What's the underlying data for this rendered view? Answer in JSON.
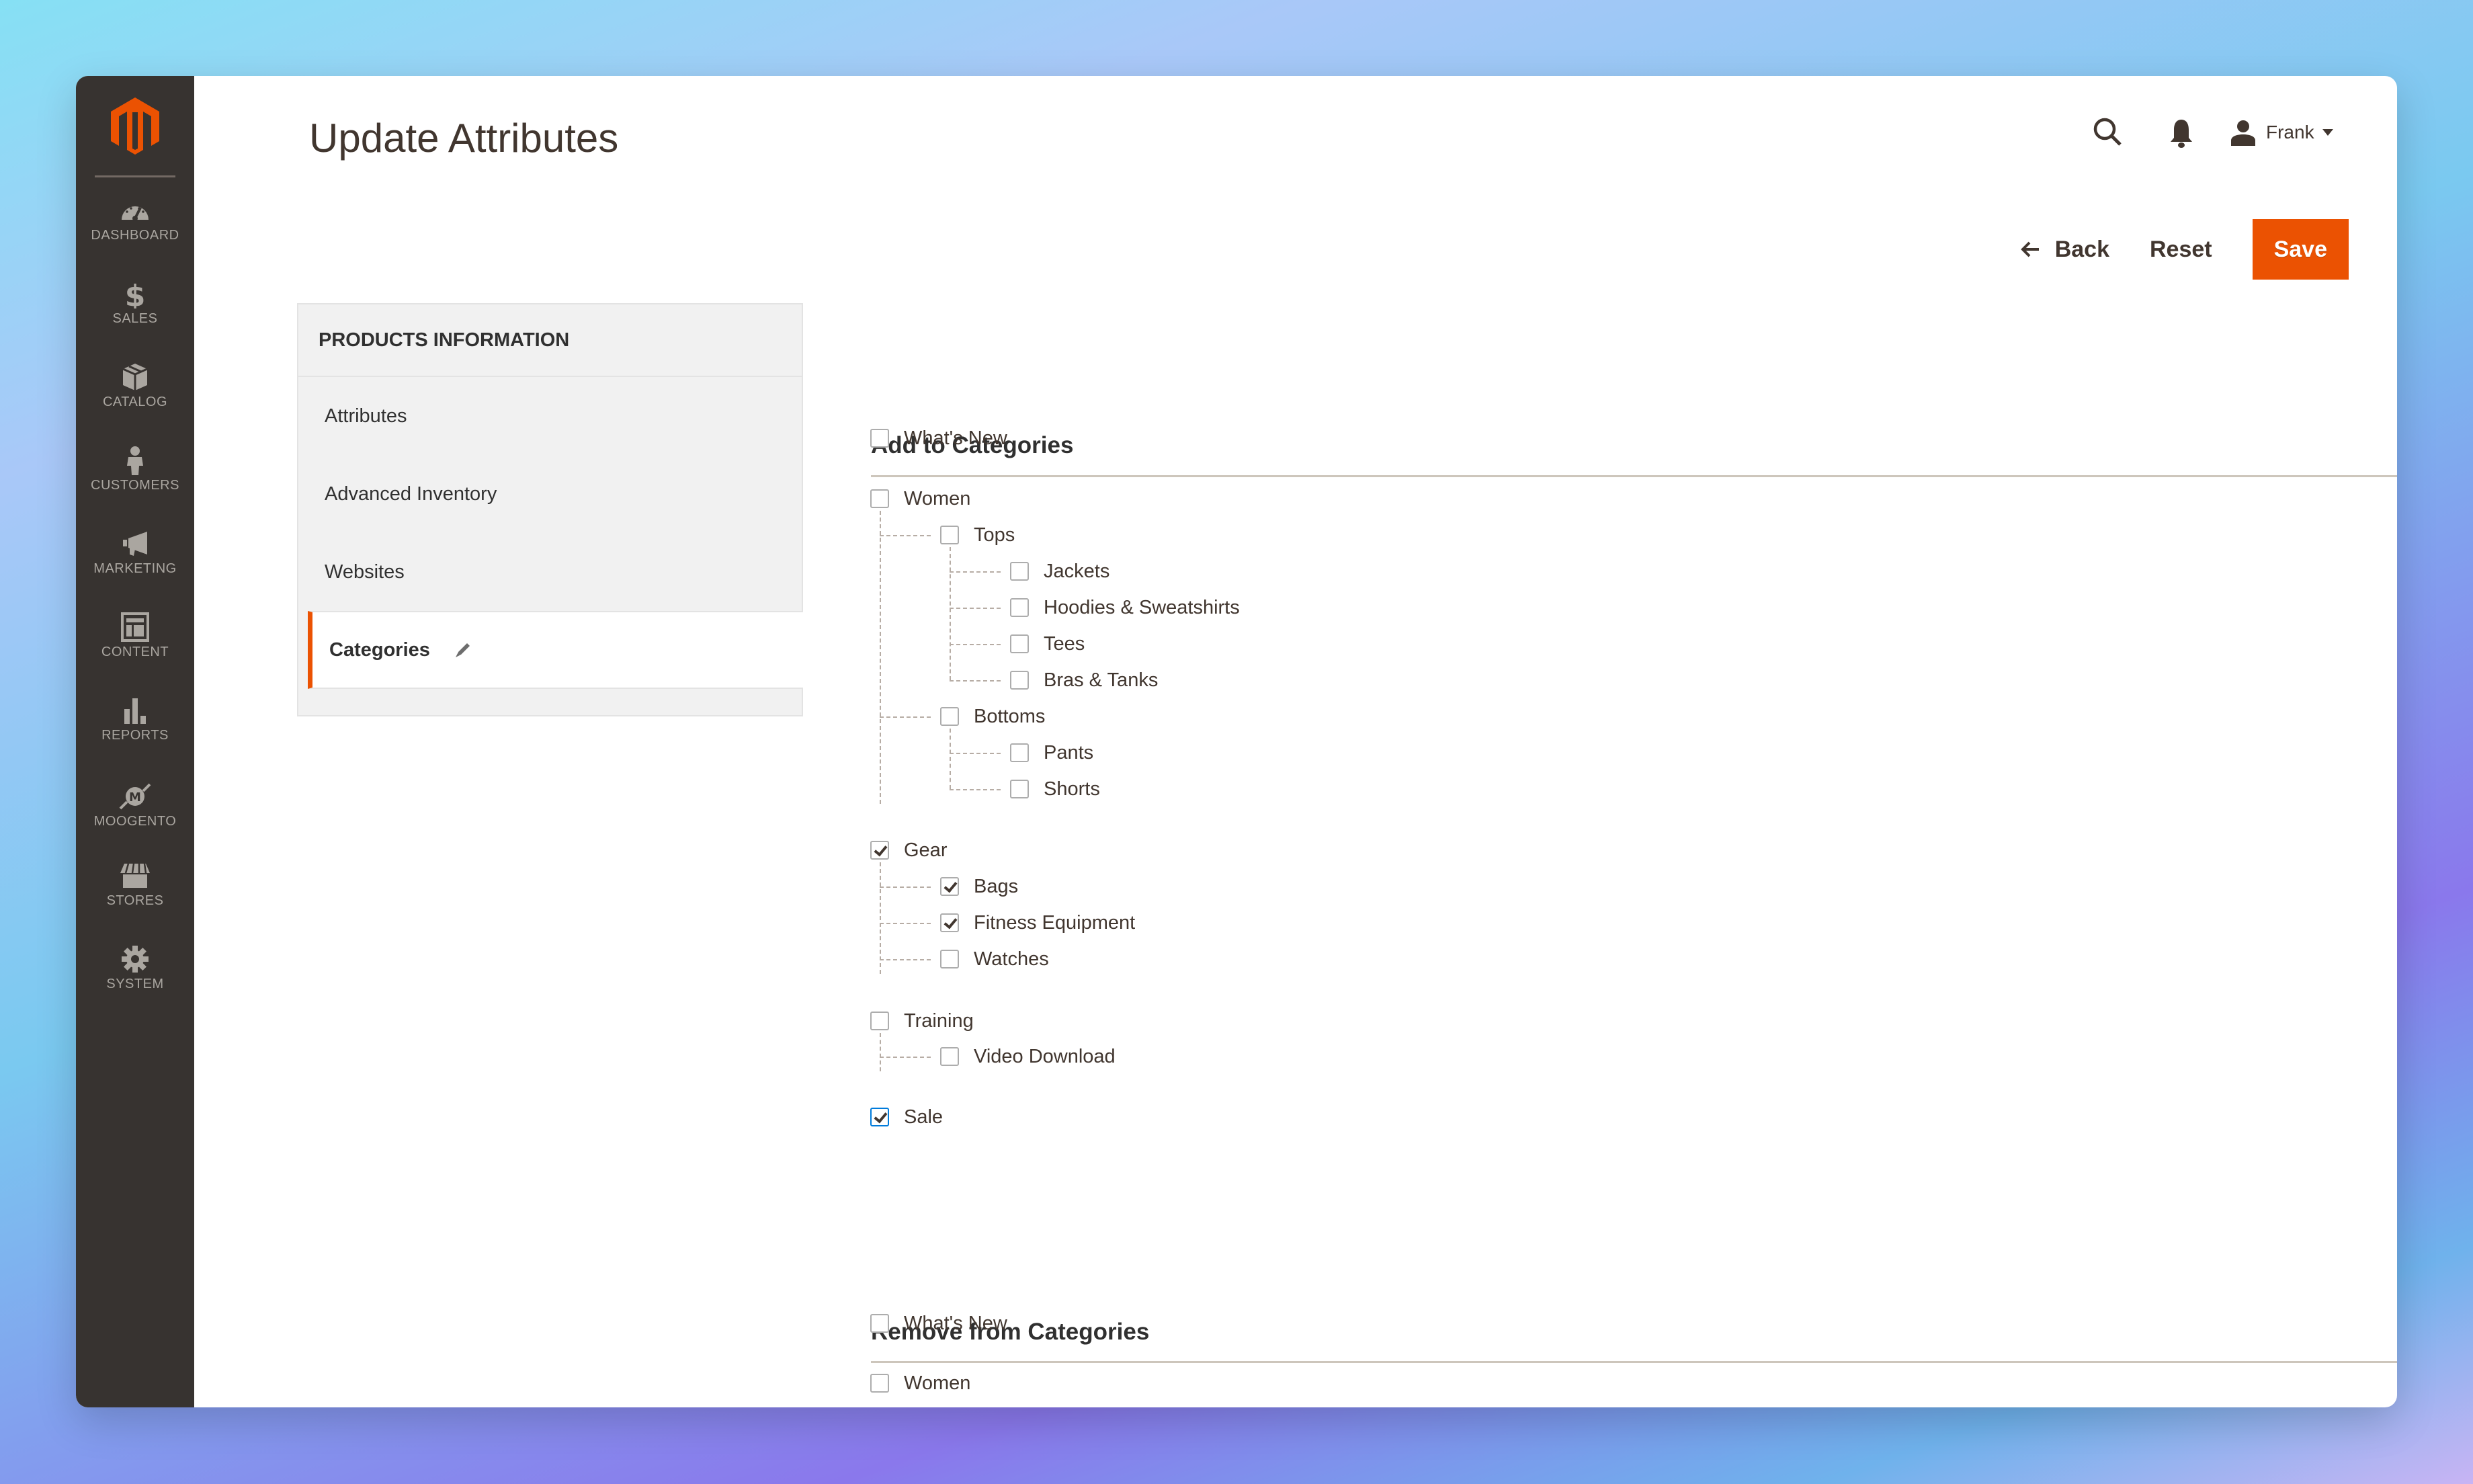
{
  "app": {
    "brand": "Magento Admin"
  },
  "colors": {
    "accent": "#eb5202",
    "sidebar": "#373330",
    "text": "#41362f",
    "focus": "#007bdb"
  },
  "sidebar": {
    "items": [
      {
        "label": "Dashboard",
        "icon": "dashboard-icon"
      },
      {
        "label": "Sales",
        "icon": "dollar-icon"
      },
      {
        "label": "Catalog",
        "icon": "box-icon"
      },
      {
        "label": "Customers",
        "icon": "person-icon"
      },
      {
        "label": "Marketing",
        "icon": "megaphone-icon"
      },
      {
        "label": "Content",
        "icon": "layout-icon"
      },
      {
        "label": "Reports",
        "icon": "bar-chart-icon"
      },
      {
        "label": "Moogento",
        "icon": "moogento-icon"
      },
      {
        "label": "Stores",
        "icon": "storefront-icon"
      },
      {
        "label": "System",
        "icon": "gear-icon"
      }
    ]
  },
  "header": {
    "title": "Update Attributes",
    "user_name": "Frank"
  },
  "actions": {
    "back": "Back",
    "reset": "Reset",
    "save": "Save"
  },
  "tabs": {
    "heading": "PRODUCTS INFORMATION",
    "items": [
      {
        "label": "Attributes",
        "active": false
      },
      {
        "label": "Advanced Inventory",
        "active": false
      },
      {
        "label": "Websites",
        "active": false
      },
      {
        "label": "Categories",
        "active": true
      }
    ]
  },
  "add_section": {
    "title": "Add to Categories",
    "tree": [
      {
        "label": "What's New",
        "checked": false,
        "level": 0
      },
      {
        "label": "Women",
        "checked": false,
        "level": 0
      },
      {
        "label": "Tops",
        "checked": false,
        "level": 1
      },
      {
        "label": "Jackets",
        "checked": false,
        "level": 2
      },
      {
        "label": "Hoodies & Sweatshirts",
        "checked": false,
        "level": 2
      },
      {
        "label": "Tees",
        "checked": false,
        "level": 2
      },
      {
        "label": "Bras & Tanks",
        "checked": false,
        "level": 2
      },
      {
        "label": "Bottoms",
        "checked": false,
        "level": 1
      },
      {
        "label": "Pants",
        "checked": false,
        "level": 2
      },
      {
        "label": "Shorts",
        "checked": false,
        "level": 2
      },
      {
        "label": "Gear",
        "checked": true,
        "level": 0
      },
      {
        "label": "Bags",
        "checked": true,
        "level": 1
      },
      {
        "label": "Fitness Equipment",
        "checked": true,
        "level": 1
      },
      {
        "label": "Watches",
        "checked": false,
        "level": 1
      },
      {
        "label": "Training",
        "checked": false,
        "level": 0
      },
      {
        "label": "Video Download",
        "checked": false,
        "level": 1
      },
      {
        "label": "Sale",
        "checked": true,
        "level": 0,
        "focused": true
      }
    ]
  },
  "remove_section": {
    "title": "Remove from Categories",
    "tree": [
      {
        "label": "What's New",
        "checked": false,
        "level": 0
      },
      {
        "label": "Women",
        "checked": false,
        "level": 0
      }
    ]
  }
}
